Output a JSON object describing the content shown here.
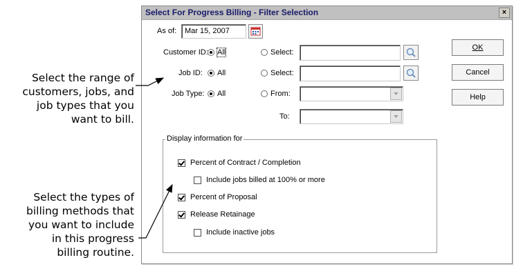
{
  "callouts": {
    "range": [
      "Select the range of",
      "customers, jobs, and",
      "job types that you",
      "want to bill."
    ],
    "methods": [
      "Select the types of",
      "billing methods that",
      "you want to include",
      "in this progress",
      "billing routine."
    ]
  },
  "dialog": {
    "title": "Select For Progress Billing - Filter Selection",
    "close": "×",
    "as_of_label": "As of:",
    "as_of_value": "Mar 15, 2007",
    "customer_label": "Customer ID:",
    "job_label": "Job ID:",
    "jobtype_label": "Job Type:",
    "all_label": "All",
    "select_label": "Select:",
    "from_label": "From:",
    "to_label": "To:",
    "buttons": {
      "ok": "OK",
      "cancel": "Cancel",
      "help": "Help"
    },
    "group_label": "Display information for",
    "options": {
      "percent_contract": "Percent of Contract / Completion",
      "include_100": "Include jobs billed at 100% or more",
      "percent_proposal": "Percent of Proposal",
      "release_retainage": "Release Retainage",
      "include_inactive": "Include inactive jobs"
    },
    "checked": {
      "percent_contract": true,
      "include_100": false,
      "percent_proposal": true,
      "release_retainage": true,
      "include_inactive": false
    }
  }
}
